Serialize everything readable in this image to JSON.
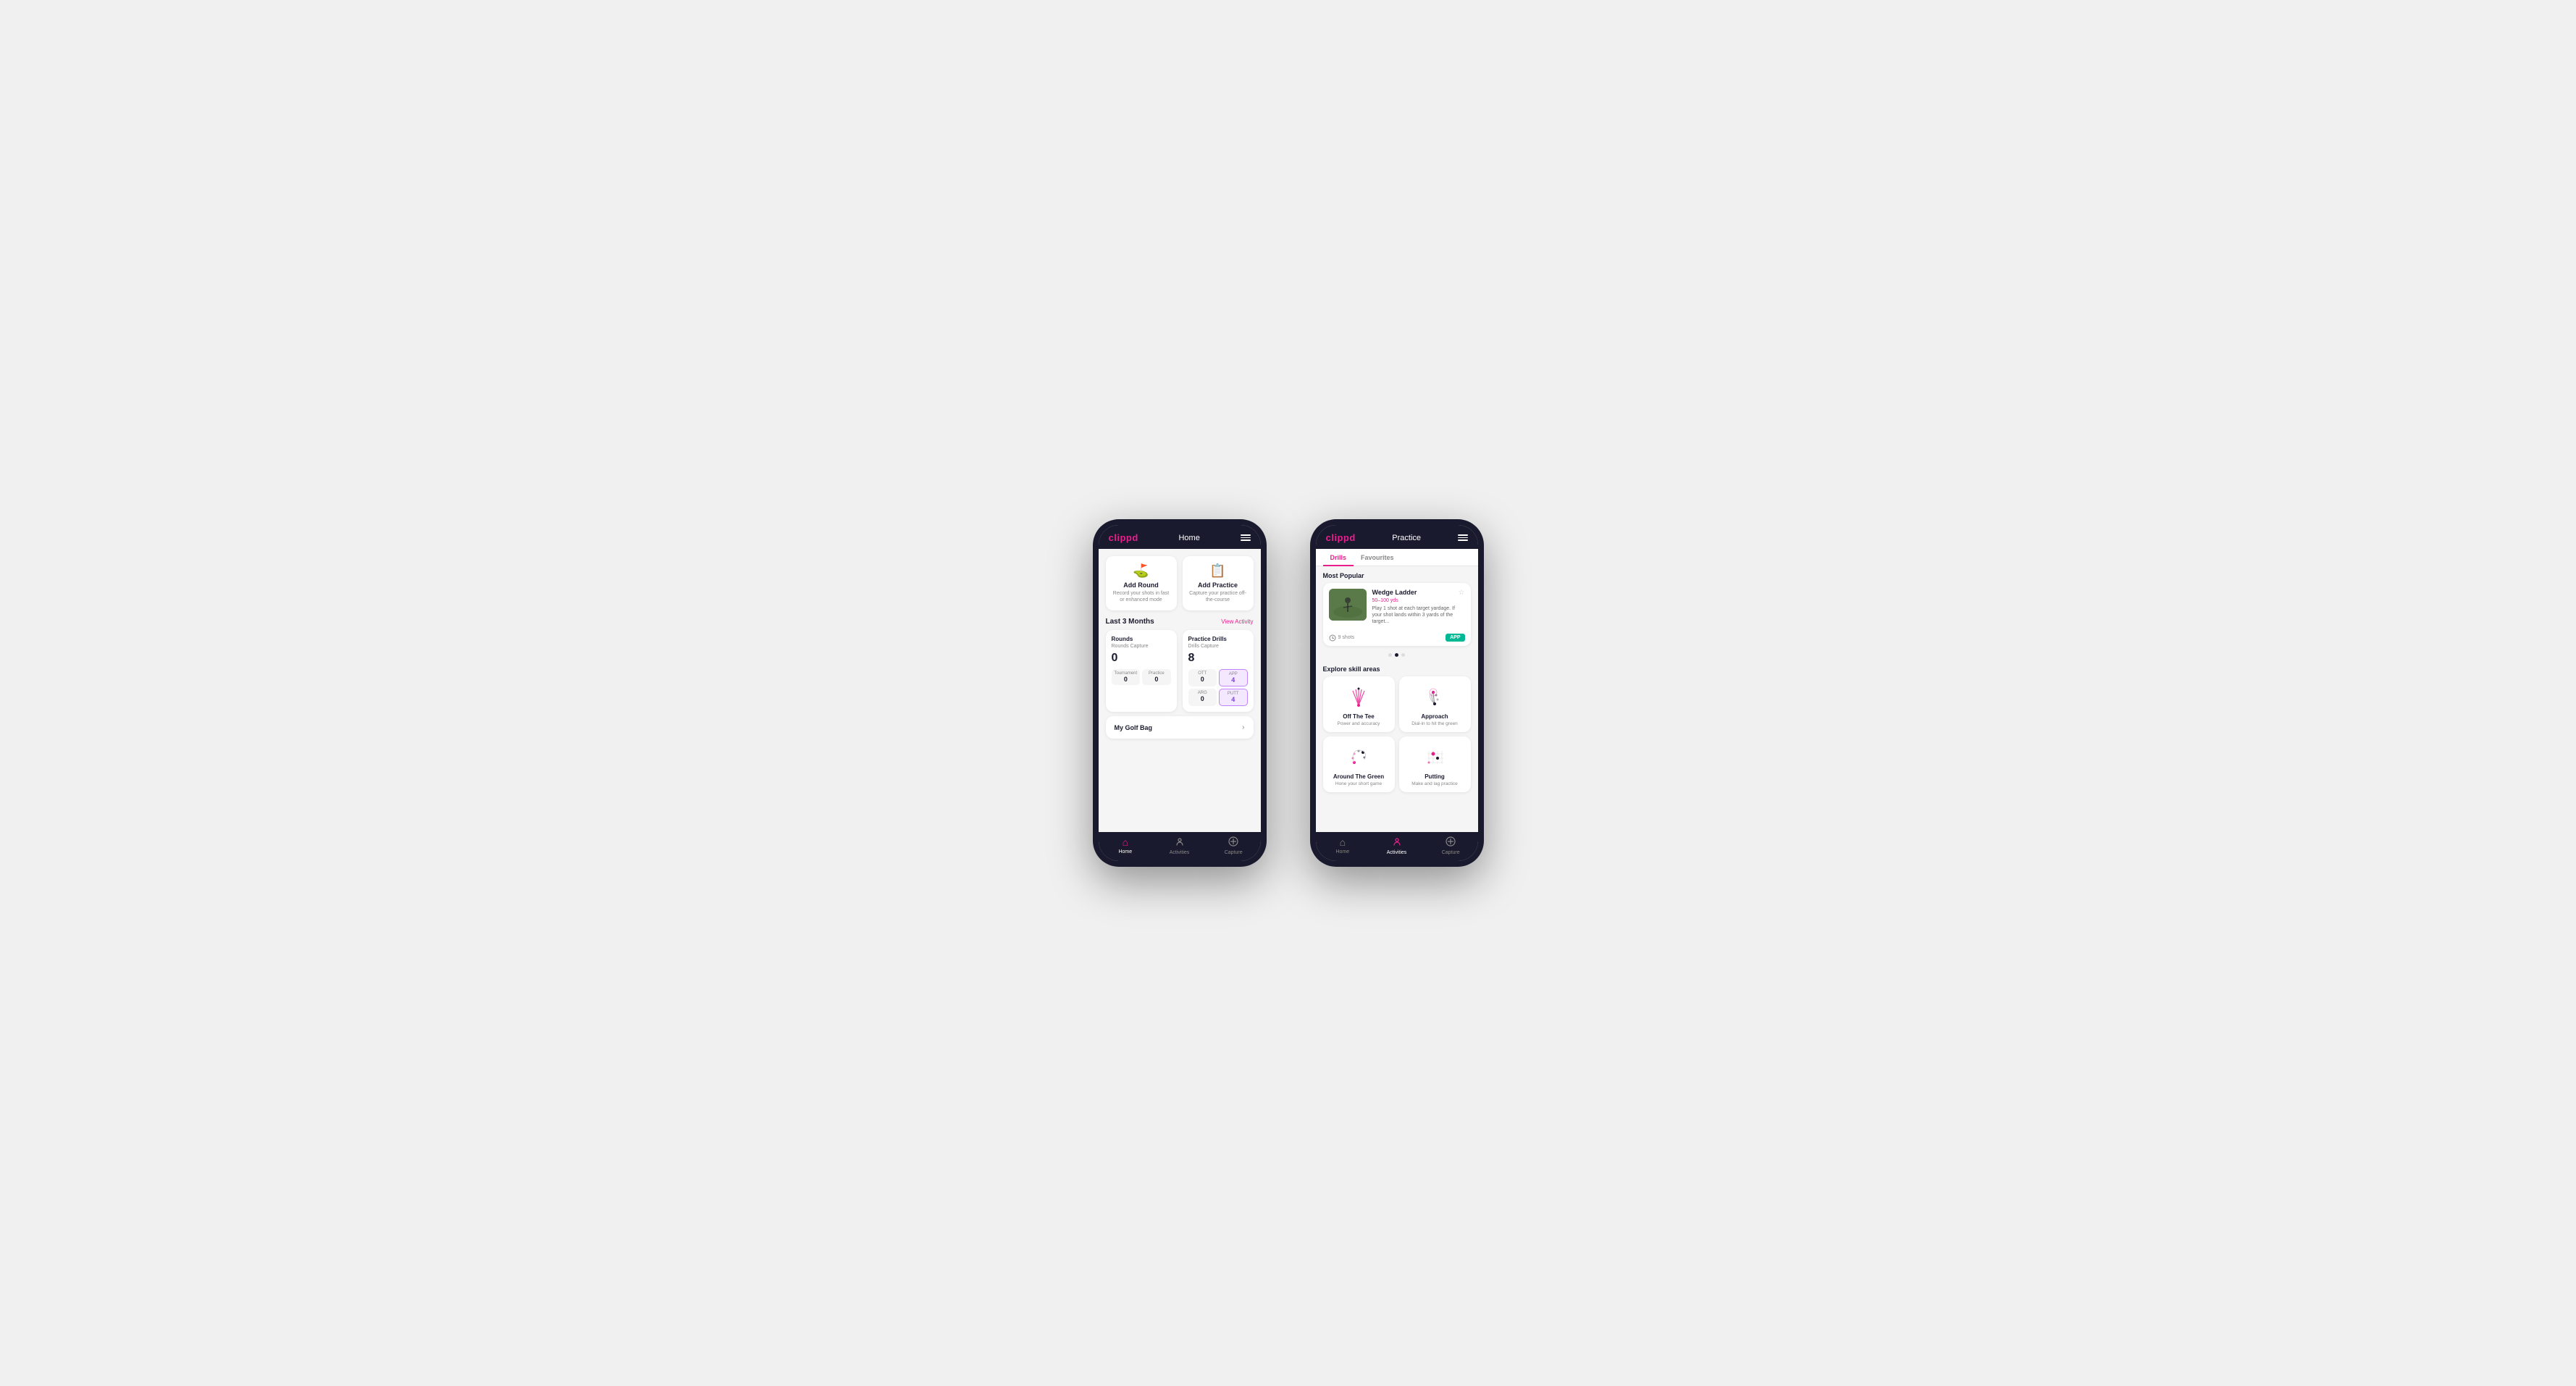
{
  "phone1": {
    "header": {
      "logo": "clippd",
      "title": "Home"
    },
    "quick_actions": [
      {
        "id": "add-round",
        "icon": "⛳",
        "title": "Add Round",
        "desc": "Record your shots in fast or enhanced mode"
      },
      {
        "id": "add-practice",
        "icon": "📋",
        "title": "Add Practice",
        "desc": "Capture your practice off-the-course"
      }
    ],
    "stats_section": {
      "title": "Last 3 Months",
      "link": "View Activity"
    },
    "rounds_card": {
      "title": "Rounds",
      "capture_label": "Rounds Capture",
      "total": "0",
      "sub_items": [
        {
          "label": "Tournament",
          "value": "0"
        },
        {
          "label": "Practice",
          "value": "0"
        }
      ]
    },
    "drills_card": {
      "title": "Practice Drills",
      "capture_label": "Drills Capture",
      "total": "8",
      "sub_items": [
        {
          "label": "OTT",
          "value": "0",
          "highlighted": false
        },
        {
          "label": "APP",
          "value": "4",
          "highlighted": true
        },
        {
          "label": "ARG",
          "value": "0",
          "highlighted": false
        },
        {
          "label": "PUTT",
          "value": "4",
          "highlighted": true
        }
      ]
    },
    "golf_bag": {
      "label": "My Golf Bag"
    },
    "bottom_nav": [
      {
        "id": "home",
        "icon": "🏠",
        "label": "Home",
        "active": true
      },
      {
        "id": "activities",
        "icon": "♟",
        "label": "Activities",
        "active": false
      },
      {
        "id": "capture",
        "icon": "⊕",
        "label": "Capture",
        "active": false
      }
    ]
  },
  "phone2": {
    "header": {
      "logo": "clippd",
      "title": "Practice"
    },
    "tabs": [
      {
        "id": "drills",
        "label": "Drills",
        "active": true
      },
      {
        "id": "favourites",
        "label": "Favourites",
        "active": false
      }
    ],
    "most_popular": {
      "section_title": "Most Popular",
      "drill": {
        "name": "Wedge Ladder",
        "yardage": "50–100 yds",
        "desc": "Play 1 shot at each target yardage. If your shot lands within 3 yards of the target...",
        "shots": "9 shots",
        "badge": "APP"
      },
      "dots": 3,
      "active_dot": 1
    },
    "skill_areas": {
      "section_title": "Explore skill areas",
      "skills": [
        {
          "id": "off-the-tee",
          "name": "Off The Tee",
          "desc": "Power and accuracy",
          "icon_type": "tee"
        },
        {
          "id": "approach",
          "name": "Approach",
          "desc": "Dial-in to hit the green",
          "icon_type": "approach"
        },
        {
          "id": "around-the-green",
          "name": "Around The Green",
          "desc": "Hone your short game",
          "icon_type": "atg"
        },
        {
          "id": "putting",
          "name": "Putting",
          "desc": "Make and lag practice",
          "icon_type": "putting"
        }
      ]
    },
    "bottom_nav": [
      {
        "id": "home",
        "icon": "🏠",
        "label": "Home",
        "active": false
      },
      {
        "id": "activities",
        "icon": "♟",
        "label": "Activities",
        "active": true
      },
      {
        "id": "capture",
        "icon": "⊕",
        "label": "Capture",
        "active": false
      }
    ]
  },
  "colors": {
    "brand_pink": "#e91e8c",
    "dark_navy": "#1a1a2e",
    "green_badge": "#00b894"
  }
}
